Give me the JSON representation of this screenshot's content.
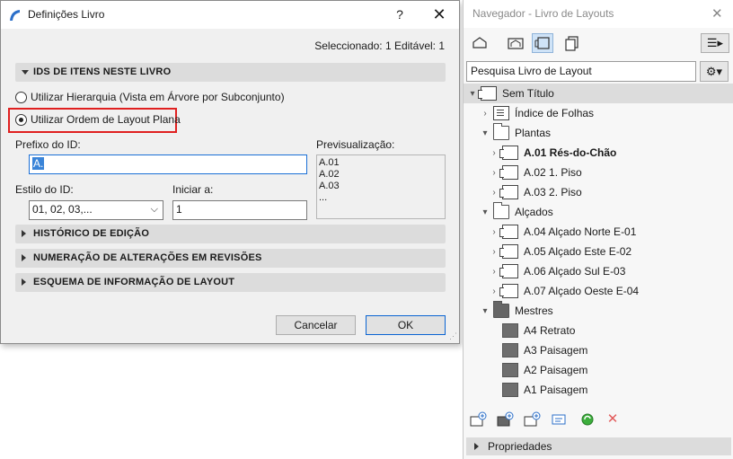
{
  "dialog": {
    "title": "Definições Livro",
    "help": "?",
    "close": "✕",
    "selection_status": "Seleccionado: 1 Editável: 1",
    "section_ids": "IDS DE ITENS NESTE LIVRO",
    "radio_hierarchy": "Utilizar Hierarquia (Vista em Árvore por Subconjunto)",
    "radio_flat": "Utilizar Ordem de Layout Plana",
    "selected_radio": "flat",
    "prefix_label": "Prefixo do ID:",
    "prefix_value": "A.",
    "preview_label": "Previsualização:",
    "preview_lines": [
      "A.01",
      "A.02",
      "A.03",
      "..."
    ],
    "style_label": "Estilo do ID:",
    "style_value": "01, 02, 03,...",
    "start_label": "Iniciar a:",
    "start_value": "1",
    "section_history": "HISTÓRICO DE EDIÇÃO",
    "section_revisions": "NUMERAÇÃO DE ALTERAÇÕES EM REVISÕES",
    "section_scheme": "ESQUEMA DE INFORMAÇÃO DE LAYOUT",
    "cancel": "Cancelar",
    "ok": "OK"
  },
  "navigator": {
    "title": "Navegador - Livro de Layouts",
    "close": "✕",
    "search_placeholder": "Pesquisa Livro de Layout",
    "tree": {
      "root": "Sem Título",
      "index": "Índice de Folhas",
      "plantas": "Plantas",
      "plantas_items": [
        "A.01 Rés-do-Chão",
        "A.02 1. Piso",
        "A.03 2. Piso"
      ],
      "alcados": "Alçados",
      "alcados_items": [
        "A.04 Alçado Norte E-01",
        "A.05 Alçado Este E-02",
        "A.06 Alçado Sul E-03",
        "A.07 Alçado Oeste E-04"
      ],
      "mestres": "Mestres",
      "mestres_items": [
        "A4 Retrato",
        "A3 Paisagem",
        "A2 Paisagem",
        "A1 Paisagem"
      ]
    },
    "properties": "Propriedades"
  }
}
